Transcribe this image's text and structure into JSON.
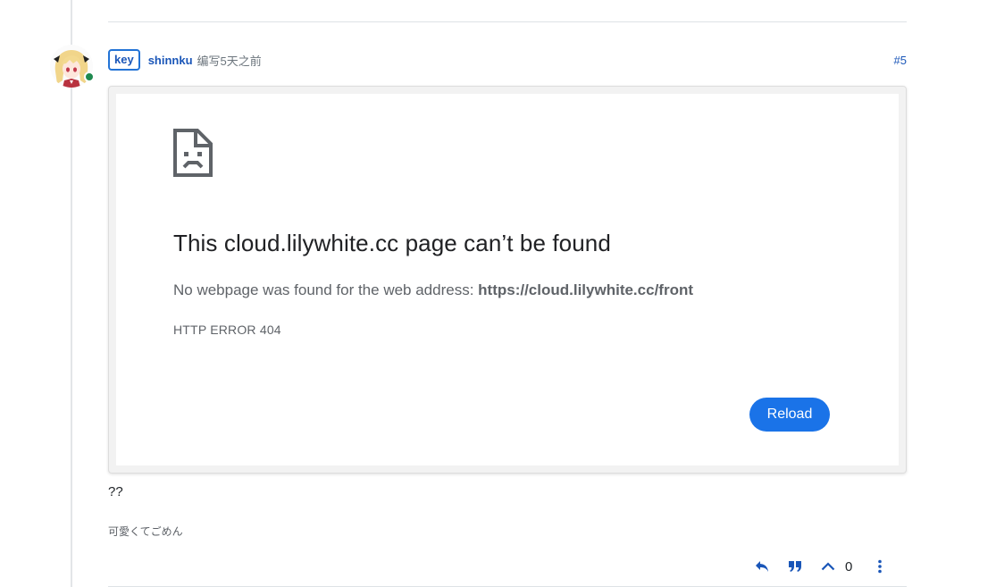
{
  "post": {
    "group_badge": "key",
    "username": "shinnku",
    "timestamp": "编写5天之前",
    "index": "#5",
    "text": "??",
    "signature": "可愛くてごめん",
    "vote_count": "0",
    "online_status_color": "#1f8a50"
  },
  "embedded_screenshot": {
    "icon": "sad-document-icon",
    "title": "This cloud.lilywhite.cc page can’t be found",
    "description_prefix": "No webpage was found for the web address: ",
    "description_url": "https://cloud.lilywhite.cc/front",
    "error_code": "HTTP ERROR 404",
    "reload_label": "Reload",
    "reload_color": "#1a73e8"
  },
  "actions": [
    {
      "icon": "reply-icon"
    },
    {
      "icon": "quote-icon"
    },
    {
      "icon": "upvote-chevron-icon"
    },
    {
      "icon": "more-vertical-icon"
    }
  ],
  "colors": {
    "accent": "#1a56b8",
    "divider": "#dee2e6"
  }
}
